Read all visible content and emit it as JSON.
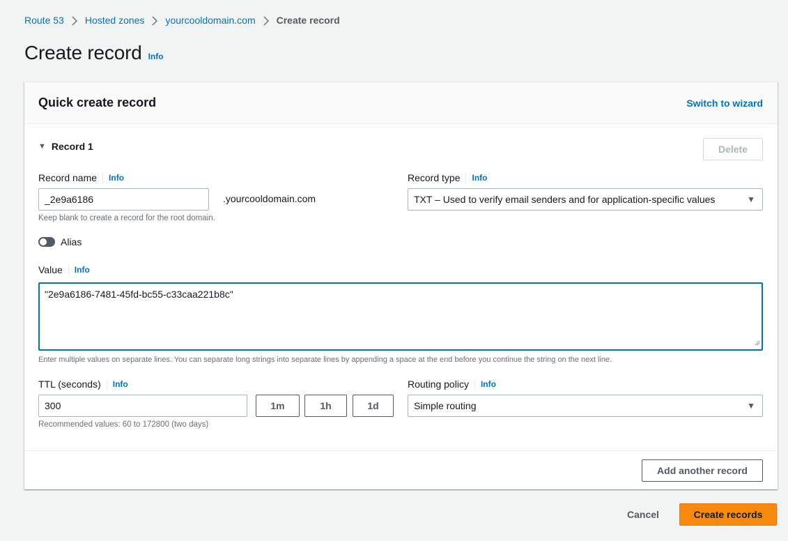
{
  "breadcrumb": [
    {
      "label": "Route 53",
      "link": true
    },
    {
      "label": "Hosted zones",
      "link": true
    },
    {
      "label": "yourcooldomain.com",
      "link": true
    },
    {
      "label": "Create record",
      "link": false
    }
  ],
  "page": {
    "title": "Create record",
    "info": "Info"
  },
  "panel": {
    "title": "Quick create record",
    "switch_link": "Switch to wizard",
    "record_heading": "Record 1",
    "delete_label": "Delete",
    "record_name": {
      "label": "Record name",
      "info": "Info",
      "value": "_2e9a6186",
      "suffix": ".yourcooldomain.com",
      "hint": "Keep blank to create a record for the root domain."
    },
    "record_type": {
      "label": "Record type",
      "info": "Info",
      "selected": "TXT – Used to verify email senders and for application-specific values"
    },
    "alias": {
      "label": "Alias",
      "enabled": false
    },
    "value": {
      "label": "Value",
      "info": "Info",
      "text": "\"2e9a6186-7481-45fd-bc55-c33caa221b8c\"",
      "hint": "Enter multiple values on separate lines. You can separate long strings into separate lines by appending a space at the end before you continue the string on the next line."
    },
    "ttl": {
      "label": "TTL (seconds)",
      "info": "Info",
      "value": "300",
      "presets": [
        "1m",
        "1h",
        "1d"
      ],
      "hint": "Recommended values: 60 to 172800 (two days)"
    },
    "routing_policy": {
      "label": "Routing policy",
      "info": "Info",
      "selected": "Simple routing"
    },
    "add_another_label": "Add another record"
  },
  "footer": {
    "cancel_label": "Cancel",
    "create_label": "Create records"
  },
  "colors": {
    "link": "#0073bb",
    "primary_button": "#f7890c",
    "focus_border": "#0073bb"
  }
}
